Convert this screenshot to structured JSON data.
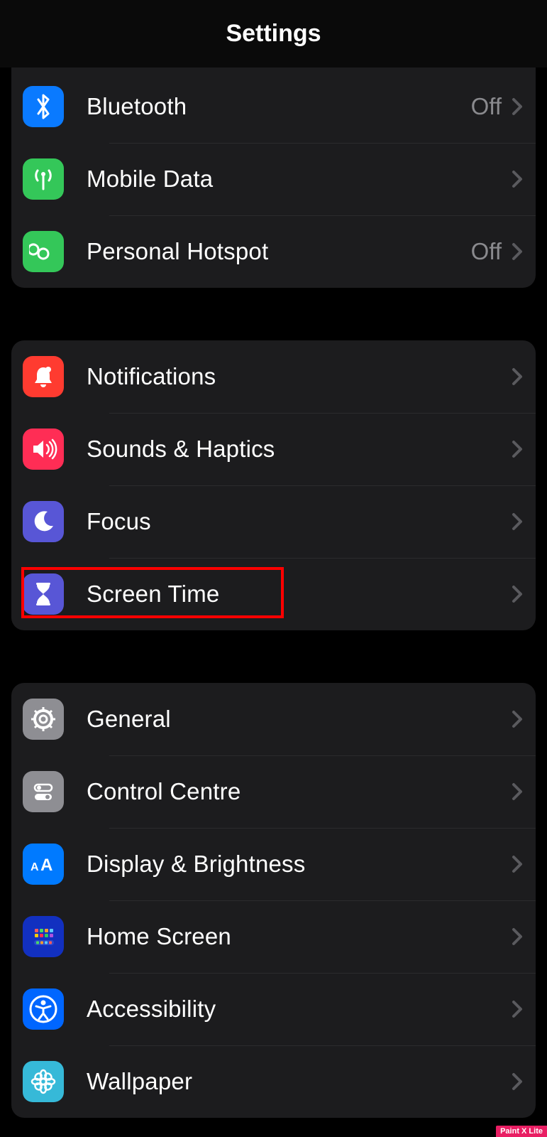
{
  "header": {
    "title": "Settings"
  },
  "groups": [
    {
      "items": [
        {
          "id": "bluetooth",
          "label": "Bluetooth",
          "value": "Off",
          "icon": "bluetooth",
          "bg": "bg-blue"
        },
        {
          "id": "mobile-data",
          "label": "Mobile Data",
          "value": "",
          "icon": "antenna",
          "bg": "bg-green"
        },
        {
          "id": "personal-hotspot",
          "label": "Personal Hotspot",
          "value": "Off",
          "icon": "link",
          "bg": "bg-green"
        }
      ]
    },
    {
      "items": [
        {
          "id": "notifications",
          "label": "Notifications",
          "value": "",
          "icon": "bell",
          "bg": "bg-red"
        },
        {
          "id": "sounds-haptics",
          "label": "Sounds & Haptics",
          "value": "",
          "icon": "speaker",
          "bg": "bg-pink"
        },
        {
          "id": "focus",
          "label": "Focus",
          "value": "",
          "icon": "moon",
          "bg": "bg-purple"
        },
        {
          "id": "screen-time",
          "label": "Screen Time",
          "value": "",
          "icon": "hourglass",
          "bg": "bg-purple"
        }
      ]
    },
    {
      "items": [
        {
          "id": "general",
          "label": "General",
          "value": "",
          "icon": "gear",
          "bg": "bg-gray"
        },
        {
          "id": "control-centre",
          "label": "Control Centre",
          "value": "",
          "icon": "switches",
          "bg": "bg-gray"
        },
        {
          "id": "display-brightness",
          "label": "Display & Brightness",
          "value": "",
          "icon": "aa",
          "bg": "bg-blue2"
        },
        {
          "id": "home-screen",
          "label": "Home Screen",
          "value": "",
          "icon": "grid",
          "bg": "bg-home"
        },
        {
          "id": "accessibility",
          "label": "Accessibility",
          "value": "",
          "icon": "person-circle",
          "bg": "bg-blue3"
        },
        {
          "id": "wallpaper",
          "label": "Wallpaper",
          "value": "",
          "icon": "flower",
          "bg": "bg-cyan"
        }
      ]
    }
  ],
  "highlight": {
    "targetId": "screen-time"
  },
  "watermark": "Paint X Lite"
}
